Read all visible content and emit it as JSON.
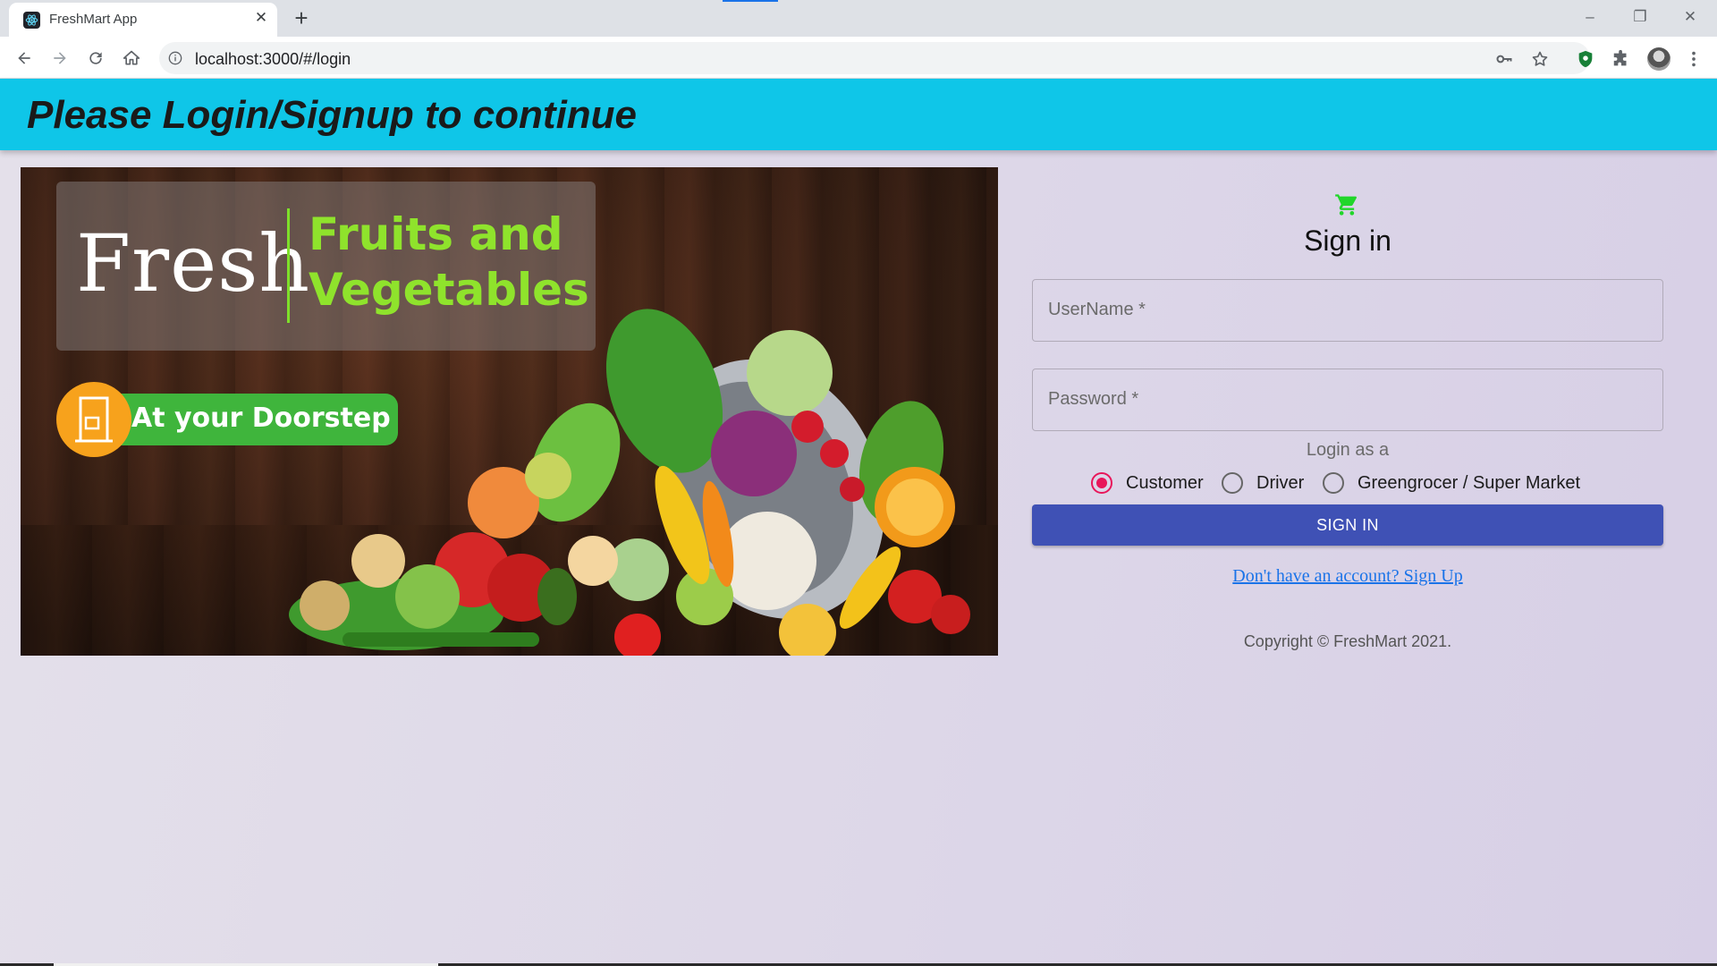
{
  "browser": {
    "tab_title": "FreshMart App",
    "tab_close": "✕",
    "new_tab": "+",
    "url": "localhost:3000/#/login",
    "window_controls": {
      "minimize": "–",
      "restore": "❐",
      "close": "✕"
    }
  },
  "appbar": {
    "title": "Please Login/Signup to continue"
  },
  "banner": {
    "logo_text": "Fresh",
    "headline_line1": "Fruits and",
    "headline_line2": "Vegetables",
    "tagline": "At your Doorstep"
  },
  "signin": {
    "icon": "shopping-cart-icon",
    "title": "Sign in",
    "username_label": "UserName *",
    "password_label": "Password *",
    "login_as_label": "Login as a",
    "roles": [
      {
        "label": "Customer",
        "selected": true
      },
      {
        "label": "Driver",
        "selected": false
      },
      {
        "label": "Greengrocer / Super Market",
        "selected": false
      }
    ],
    "submit_label": "SIGN IN",
    "signup_link": "Don't have an account? Sign Up",
    "copyright": "Copyright © FreshMart 2021."
  },
  "colors": {
    "appbar": "#0fc6e8",
    "primary_button": "#3f51b5",
    "radio_selected": "#e8165a",
    "cart_icon": "#21d62a",
    "link": "#1a73e8"
  }
}
